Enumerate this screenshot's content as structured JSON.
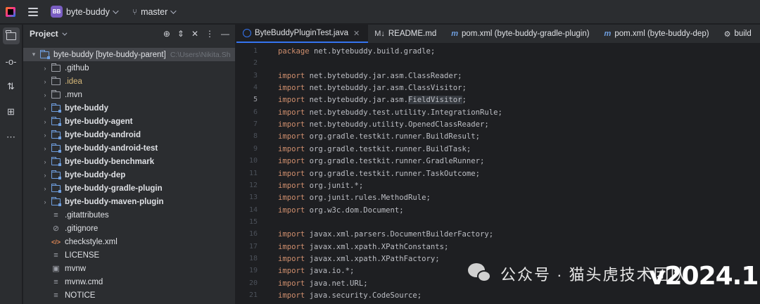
{
  "titlebar": {
    "project_badge": "BB",
    "project_name": "byte-buddy",
    "branch": "master"
  },
  "toolstrip": [
    "project-icon",
    "commit-icon",
    "pull-requests-icon",
    "structure-icon",
    "more-icon"
  ],
  "project_panel": {
    "title": "Project",
    "root": {
      "label": "byte-buddy [byte-buddy-parent]",
      "path": "C:\\Users\\Nikita.Sh"
    },
    "items": [
      {
        "label": ".github",
        "type": "folder"
      },
      {
        "label": ".idea",
        "type": "folder"
      },
      {
        "label": ".mvn",
        "type": "folder"
      },
      {
        "label": "byte-buddy",
        "type": "module"
      },
      {
        "label": "byte-buddy-agent",
        "type": "module"
      },
      {
        "label": "byte-buddy-android",
        "type": "module"
      },
      {
        "label": "byte-buddy-android-test",
        "type": "module"
      },
      {
        "label": "byte-buddy-benchmark",
        "type": "module"
      },
      {
        "label": "byte-buddy-dep",
        "type": "module"
      },
      {
        "label": "byte-buddy-gradle-plugin",
        "type": "module"
      },
      {
        "label": "byte-buddy-maven-plugin",
        "type": "module"
      },
      {
        "label": ".gitattributes",
        "type": "file"
      },
      {
        "label": ".gitignore",
        "type": "ignore"
      },
      {
        "label": "checkstyle.xml",
        "type": "xml"
      },
      {
        "label": "LICENSE",
        "type": "file"
      },
      {
        "label": "mvnw",
        "type": "shell"
      },
      {
        "label": "mvnw.cmd",
        "type": "file"
      },
      {
        "label": "NOTICE",
        "type": "file"
      }
    ]
  },
  "tabs": [
    {
      "label": "ByteBuddyPluginTest.java",
      "icon": "java-class-icon",
      "active": true
    },
    {
      "label": "README.md",
      "icon": "markdown-icon"
    },
    {
      "label": "pom.xml (byte-buddy-gradle-plugin)",
      "icon": "maven-icon"
    },
    {
      "label": "pom.xml (byte-buddy-dep)",
      "icon": "maven-icon"
    },
    {
      "label": "build",
      "icon": "gradle-icon"
    }
  ],
  "editor": {
    "current_line": 5,
    "lines": [
      {
        "n": "1",
        "kw": "package",
        "rest": " net.bytebuddy.build.gradle;"
      },
      {
        "n": "2",
        "kw": "",
        "rest": ""
      },
      {
        "n": "3",
        "kw": "import",
        "rest": " net.bytebuddy.jar.asm.ClassReader;"
      },
      {
        "n": "4",
        "kw": "import",
        "rest": " net.bytebuddy.jar.asm.ClassVisitor;"
      },
      {
        "n": "5",
        "kw": "import",
        "rest": " net.bytebuddy.jar.asm.FieldVisitor;"
      },
      {
        "n": "6",
        "kw": "import",
        "rest": " net.bytebuddy.test.utility.IntegrationRule;"
      },
      {
        "n": "7",
        "kw": "import",
        "rest": " net.bytebuddy.utility.OpenedClassReader;"
      },
      {
        "n": "8",
        "kw": "import",
        "rest": " org.gradle.testkit.runner.BuildResult;"
      },
      {
        "n": "9",
        "kw": "import",
        "rest": " org.gradle.testkit.runner.BuildTask;"
      },
      {
        "n": "10",
        "kw": "import",
        "rest": " org.gradle.testkit.runner.GradleRunner;"
      },
      {
        "n": "11",
        "kw": "import",
        "rest": " org.gradle.testkit.runner.TaskOutcome;"
      },
      {
        "n": "12",
        "kw": "import",
        "rest": " org.junit.*;"
      },
      {
        "n": "13",
        "kw": "import",
        "rest": " org.junit.rules.MethodRule;"
      },
      {
        "n": "14",
        "kw": "import",
        "rest": " org.w3c.dom.Document;"
      },
      {
        "n": "15",
        "kw": "",
        "rest": ""
      },
      {
        "n": "16",
        "kw": "import",
        "rest": " javax.xml.parsers.DocumentBuilderFactory;"
      },
      {
        "n": "17",
        "kw": "import",
        "rest": " javax.xml.xpath.XPathConstants;"
      },
      {
        "n": "18",
        "kw": "import",
        "rest": " javax.xml.xpath.XPathFactory;"
      },
      {
        "n": "19",
        "kw": "import",
        "rest": " java.io.*;"
      },
      {
        "n": "20",
        "kw": "import",
        "rest": " java.net.URL;"
      },
      {
        "n": "21",
        "kw": "import",
        "rest": " java.security.CodeSource;"
      }
    ]
  },
  "watermark": {
    "text": "公众号 · 猫头虎技术团队",
    "version": "v2024.1"
  },
  "colors": {
    "keyword": "#cf8e6d",
    "accent": "#3574f0",
    "background": "#1e1f22",
    "panel": "#2b2d30"
  }
}
